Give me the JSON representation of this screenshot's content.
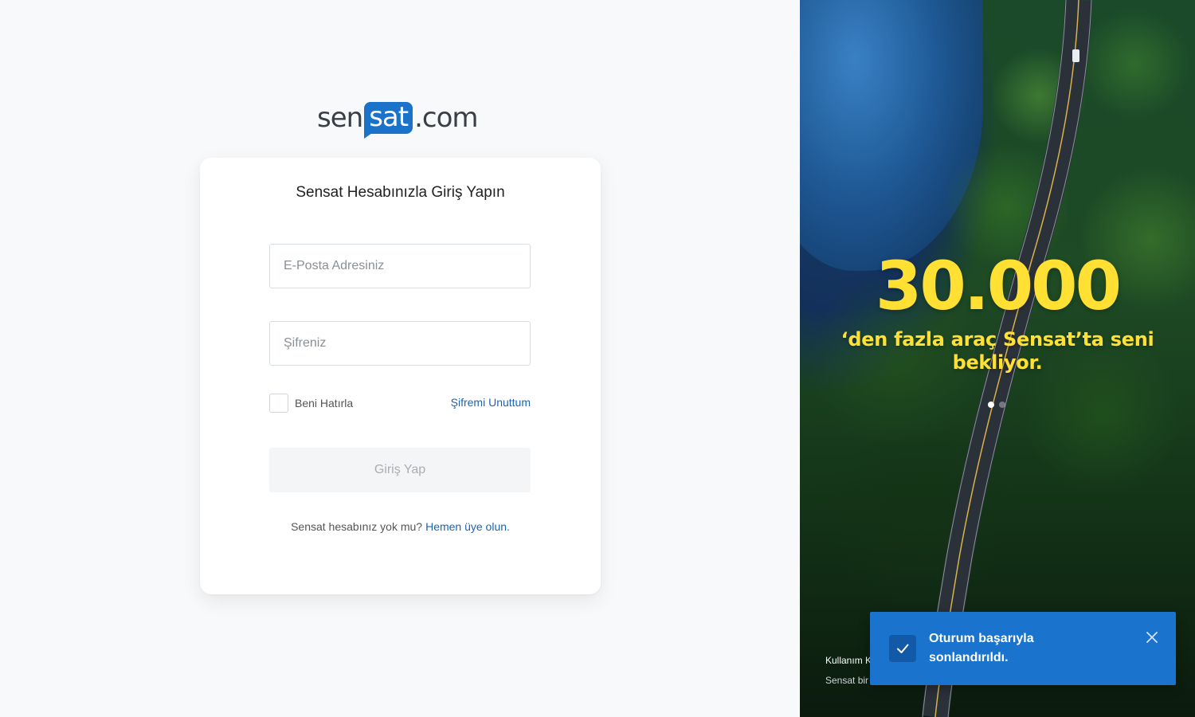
{
  "brand": {
    "logo_prefix": "sen",
    "logo_highlight": "sat",
    "logo_suffix": ".com"
  },
  "login": {
    "title": "Sensat Hesabınızla Giriş Yapın",
    "email_placeholder": "E-Posta Adresiniz",
    "password_placeholder": "Şifreniz",
    "remember_label": "Beni Hatırla",
    "forgot_label": "Şifremi Unuttum",
    "submit_label": "Giriş Yap",
    "signup_prompt": "Sensat hesabınız yok mu?",
    "signup_link": "Hemen üye olun."
  },
  "promo": {
    "number": "30.000",
    "text": "‘den fazla araç Sensat’ta seni bekliyor.",
    "slides_total": 2,
    "active_slide": 1,
    "footer_link": "Kullanım K",
    "footer_copy": "Sensat bir"
  },
  "toast": {
    "message": "Oturum başarıyla sonlandırıldı.",
    "icon": "check-icon",
    "close_icon": "close-icon"
  },
  "colors": {
    "accent": "#1a73c8",
    "link": "#1a64b4",
    "promo_yellow": "#ffe033",
    "toast_bg": "#1a73cc"
  }
}
